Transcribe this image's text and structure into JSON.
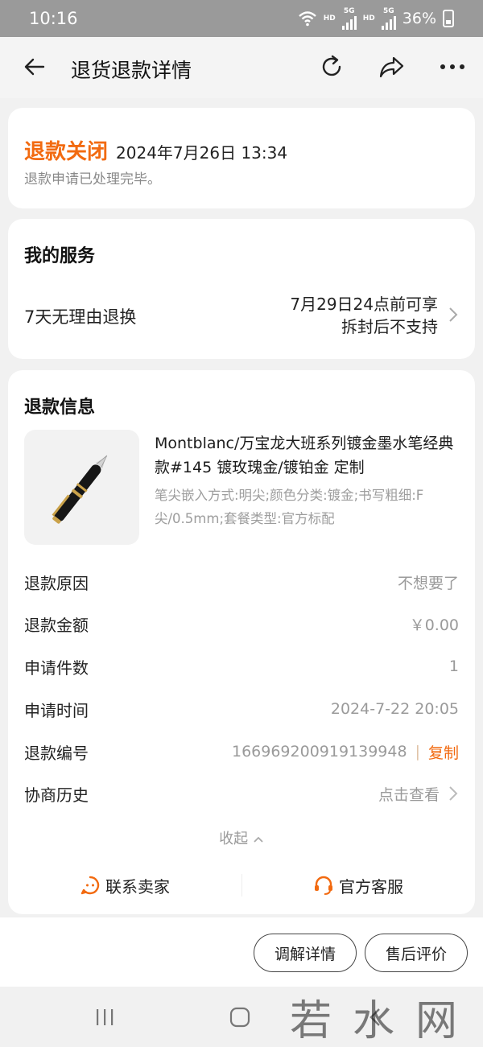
{
  "status_bar": {
    "time": "10:16",
    "hd1": "HD",
    "net1": "5G",
    "hd2": "HD",
    "net2": "5G",
    "battery": "36%"
  },
  "header": {
    "title": "退货退款详情",
    "icons": [
      "back-arrow-icon",
      "refresh-icon",
      "share-icon",
      "more-icon"
    ]
  },
  "status": {
    "title": "退款关闭",
    "time": "2024年7月26日 13:34",
    "desc": "退款申请已处理完毕。"
  },
  "service": {
    "section_title": "我的服务",
    "name": "7天无理由退换",
    "detail_line1": "7月29日24点前可享",
    "detail_line2": "拆封后不支持"
  },
  "refund": {
    "section_title": "退款信息",
    "product": {
      "title": "Montblanc/万宝龙大班系列镀金墨水笔经典款#145 镀玫瑰金/镀铂金 定制",
      "spec": "笔尖嵌入方式:明尖;颜色分类:镀金;书写粗细:F尖/0.5mm;套餐类型:官方标配"
    },
    "rows": [
      {
        "label": "退款原因",
        "value": "不想要了"
      },
      {
        "label": "退款金额",
        "value": "￥0.00"
      },
      {
        "label": "申请件数",
        "value": "1"
      },
      {
        "label": "申请时间",
        "value": "2024-7-22 20:05"
      },
      {
        "label": "退款编号",
        "value": "166969200919139948",
        "copy_sep": "|",
        "copy_label": "复制"
      },
      {
        "label": "协商历史",
        "value": "点击查看"
      }
    ],
    "collapse_label": "收起",
    "contact_seller": "联系卖家",
    "official_service": "官方客服"
  },
  "bottom_bar": {
    "mediation_btn": "调解详情",
    "review_btn": "售后评价"
  },
  "watermark": "若水网",
  "colors": {
    "accent": "#f26a10",
    "background": "#f1f1f1",
    "card": "#ffffff",
    "muted_text": "#9a9a9a"
  }
}
